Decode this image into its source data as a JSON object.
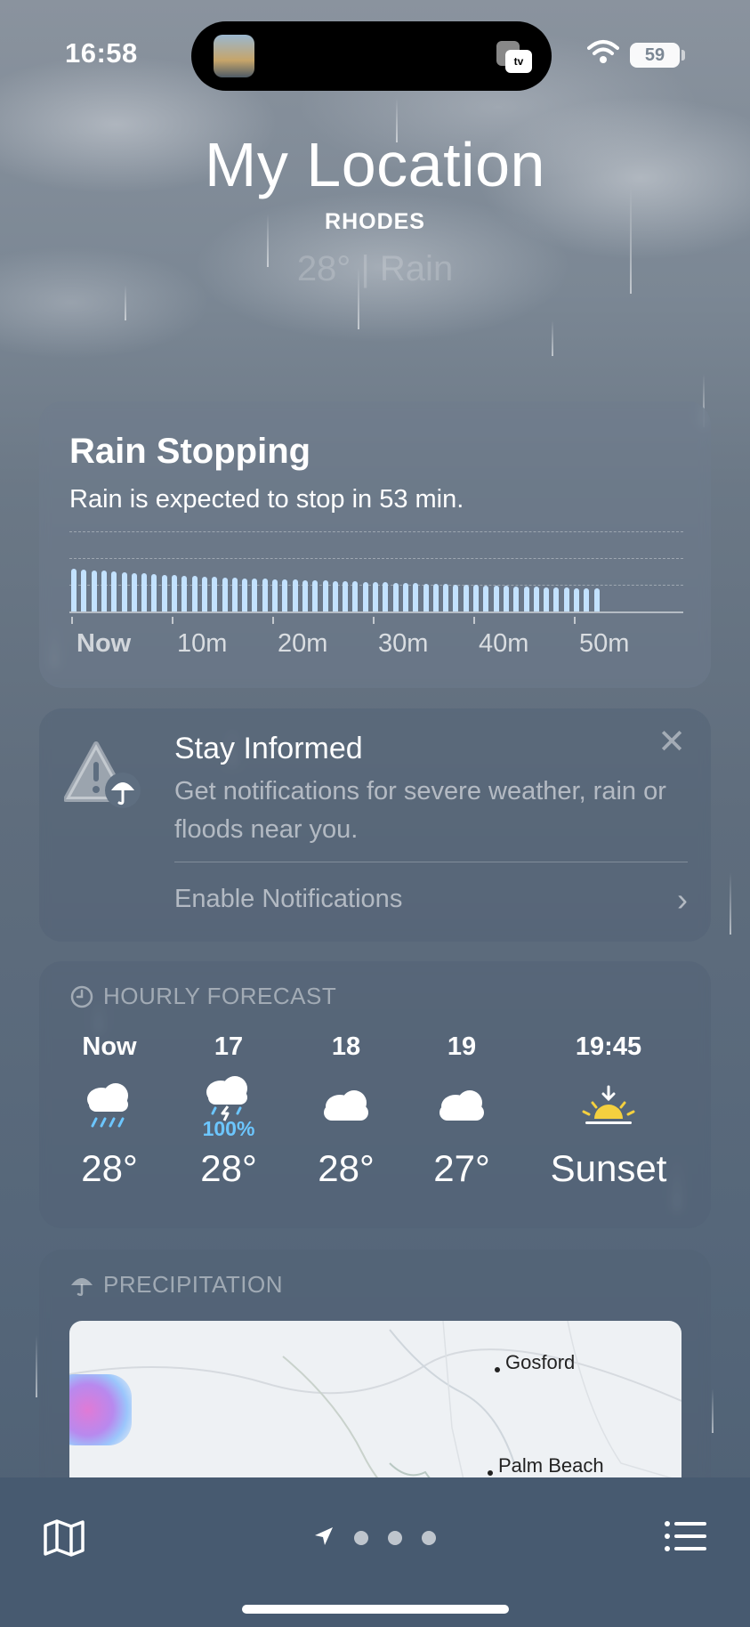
{
  "status_bar": {
    "time": "16:58",
    "island_app_label": "tv",
    "battery": "59"
  },
  "header": {
    "title": "My Location",
    "subtitle": "RHODES",
    "faded_summary": "28°  |  Rain"
  },
  "rain_card": {
    "title": "Rain Stopping",
    "description": "Rain is expected to stop in 53 min.",
    "ticks": [
      "Now",
      "10m",
      "20m",
      "30m",
      "40m",
      "50m"
    ]
  },
  "chart_data": {
    "type": "bar",
    "title": "Rain Stopping",
    "categories": [
      "Now",
      "10m",
      "20m",
      "30m",
      "40m",
      "50m"
    ],
    "minute_intensity": [
      1.0,
      0.98,
      0.96,
      0.95,
      0.93,
      0.91,
      0.9,
      0.89,
      0.87,
      0.86,
      0.85,
      0.84,
      0.83,
      0.82,
      0.81,
      0.8,
      0.79,
      0.78,
      0.77,
      0.77,
      0.76,
      0.75,
      0.74,
      0.73,
      0.73,
      0.72,
      0.71,
      0.7,
      0.7,
      0.69,
      0.68,
      0.68,
      0.67,
      0.66,
      0.66,
      0.65,
      0.64,
      0.64,
      0.63,
      0.62,
      0.62,
      0.61,
      0.6,
      0.6,
      0.59,
      0.58,
      0.58,
      0.57,
      0.56,
      0.56,
      0.55,
      0.55,
      0.54
    ],
    "xlabel": "",
    "ylabel": ""
  },
  "notification_card": {
    "title": "Stay Informed",
    "description": "Get notifications for severe weather, rain or floods near you.",
    "link": "Enable Notifications",
    "close_glyph": "✕",
    "chevron": "›"
  },
  "hourly": {
    "header": "HOURLY FORECAST",
    "items": [
      {
        "time": "Now",
        "icon": "cloud-rain-icon",
        "temp": "28°",
        "pct": ""
      },
      {
        "time": "17",
        "icon": "cloud-bolt-rain-icon",
        "temp": "28°",
        "pct": "100%"
      },
      {
        "time": "18",
        "icon": "cloud-icon",
        "temp": "28°",
        "pct": ""
      },
      {
        "time": "19",
        "icon": "cloud-icon",
        "temp": "27°",
        "pct": ""
      },
      {
        "time": "19:45",
        "icon": "sunset-icon",
        "temp": "Sunset",
        "pct": ""
      }
    ]
  },
  "precipitation": {
    "header": "PRECIPITATION",
    "places": [
      "Gosford",
      "Palm Beach"
    ]
  },
  "bottom_bar": {
    "page_count": 3
  },
  "colors": {
    "rain_bar": "#c3e2ff",
    "precip_pct": "#6cc6ff",
    "sunset": "#f4d03f"
  }
}
